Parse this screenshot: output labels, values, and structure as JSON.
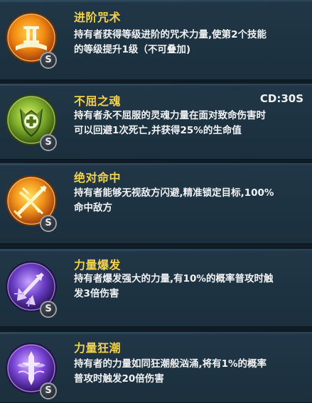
{
  "skills": [
    {
      "name": "进阶咒术",
      "desc_lines": [
        "持有者获得等级进阶的咒术力量,使第2个技能",
        "的等级提升1级（不可叠加)"
      ],
      "badge": "S",
      "icon": "roman-two-book-icon",
      "theme_color": "#f29a1c"
    },
    {
      "name": "不屈之魂",
      "cooldown": "CD:30S",
      "desc_lines": [
        "持有者永不屈服的灵魂力量在面对致命伤害时",
        "可以回避1次死亡,并获得25%的生命值"
      ],
      "badge": "S",
      "icon": "cross-shield-icon",
      "theme_color": "#8fbf33"
    },
    {
      "name": "绝对命中",
      "desc_lines": [
        "持有者能够无视敌方闪避,精准锁定目标,100%",
        "命中敌方"
      ],
      "badge": "S",
      "icon": "crossbow-target-icon",
      "theme_color": "#f2a21c"
    },
    {
      "name": "力量爆发",
      "desc_lines": [
        "持有者爆发强大的力量,有10%的概率普攻时触",
        "发3倍伤害"
      ],
      "badge": "S",
      "icon": "burst-arrow-icon",
      "theme_color": "#7a45d6"
    },
    {
      "name": "力量狂潮",
      "desc_lines": [
        "持有者的力量如同狂潮般汹涌,将有1%的概率",
        "普攻时触发20倍伤害"
      ],
      "badge": "S",
      "icon": "sword-wings-icon",
      "theme_color": "#8a4fe0"
    }
  ]
}
